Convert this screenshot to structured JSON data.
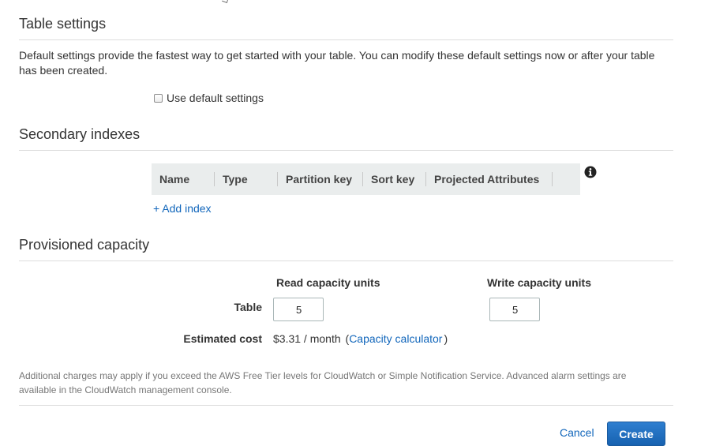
{
  "table_settings": {
    "title": "Table settings",
    "description": "Default settings provide the fastest way to get started with your table. You can modify these default settings now or after your table has been created.",
    "use_default_label": "Use default settings",
    "use_default_checked": false
  },
  "secondary_indexes": {
    "title": "Secondary indexes",
    "columns": [
      "Name",
      "Type",
      "Partition key",
      "Sort key",
      "Projected Attributes"
    ],
    "add_index_label": "+ Add index",
    "info_icon": "info-icon"
  },
  "provisioned_capacity": {
    "title": "Provisioned capacity",
    "read_header": "Read capacity units",
    "write_header": "Write capacity units",
    "table_label": "Table",
    "read_value": "5",
    "write_value": "5",
    "estimated_cost_label": "Estimated cost",
    "estimated_cost_value": "$3.31 / month",
    "paren_open": "(",
    "calculator_link": "Capacity calculator",
    "paren_close": ")"
  },
  "note": "Additional charges may apply if you exceed the AWS Free Tier levels for CloudWatch or Simple Notification Service. Advanced alarm settings are available in the CloudWatch management console.",
  "actions": {
    "cancel_label": "Cancel",
    "create_label": "Create"
  },
  "colors": {
    "link": "#1166bb",
    "primary_button": "#1762b0",
    "table_header_bg": "#eaeded",
    "divider": "#dddddd"
  }
}
